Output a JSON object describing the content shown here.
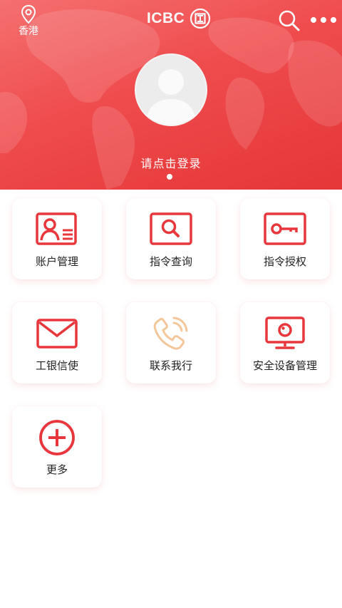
{
  "header": {
    "location_label": "香港",
    "logo_text": "ICBC",
    "login_text": "请点击登录"
  },
  "icons": {
    "location": "location-pin-icon",
    "logo_mark": "icbc-logo-icon",
    "search": "search-icon",
    "more": "more-dots-icon"
  },
  "colors": {
    "brand_red": "#e8373c",
    "phone_icon": "#f3c79a"
  },
  "grid": {
    "items": [
      {
        "label": "账户管理",
        "icon": "account-card-icon"
      },
      {
        "label": "指令查询",
        "icon": "search-screen-icon"
      },
      {
        "label": "指令授权",
        "icon": "key-icon"
      },
      {
        "label": "工银信使",
        "icon": "mail-icon"
      },
      {
        "label": "联系我行",
        "icon": "phone-icon"
      },
      {
        "label": "安全设备管理",
        "icon": "monitor-device-icon"
      },
      {
        "label": "更多",
        "icon": "plus-circle-icon"
      }
    ]
  }
}
